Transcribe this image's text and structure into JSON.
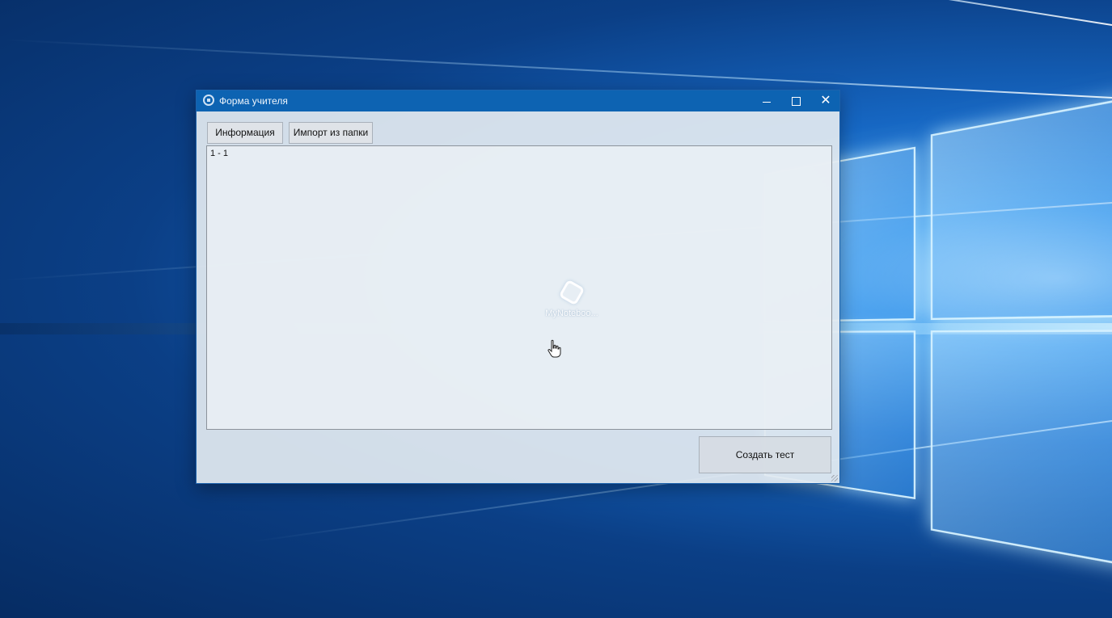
{
  "window": {
    "title": "Форма учителя"
  },
  "toolbar": {
    "info_label": "Информация",
    "import_label": "Импорт из папки"
  },
  "list": {
    "items": [
      "1 - 1"
    ]
  },
  "footer": {
    "create_test_label": "Создать тест"
  },
  "drag": {
    "label": "MyNoteboo..."
  },
  "icons": {
    "minimize": "minimize-icon",
    "maximize": "maximize-icon",
    "close": "close-icon",
    "cursor": "hand-cursor-icon"
  },
  "colors": {
    "titlebar": "#0d63b2",
    "window_bg": "#e2e9f0"
  }
}
